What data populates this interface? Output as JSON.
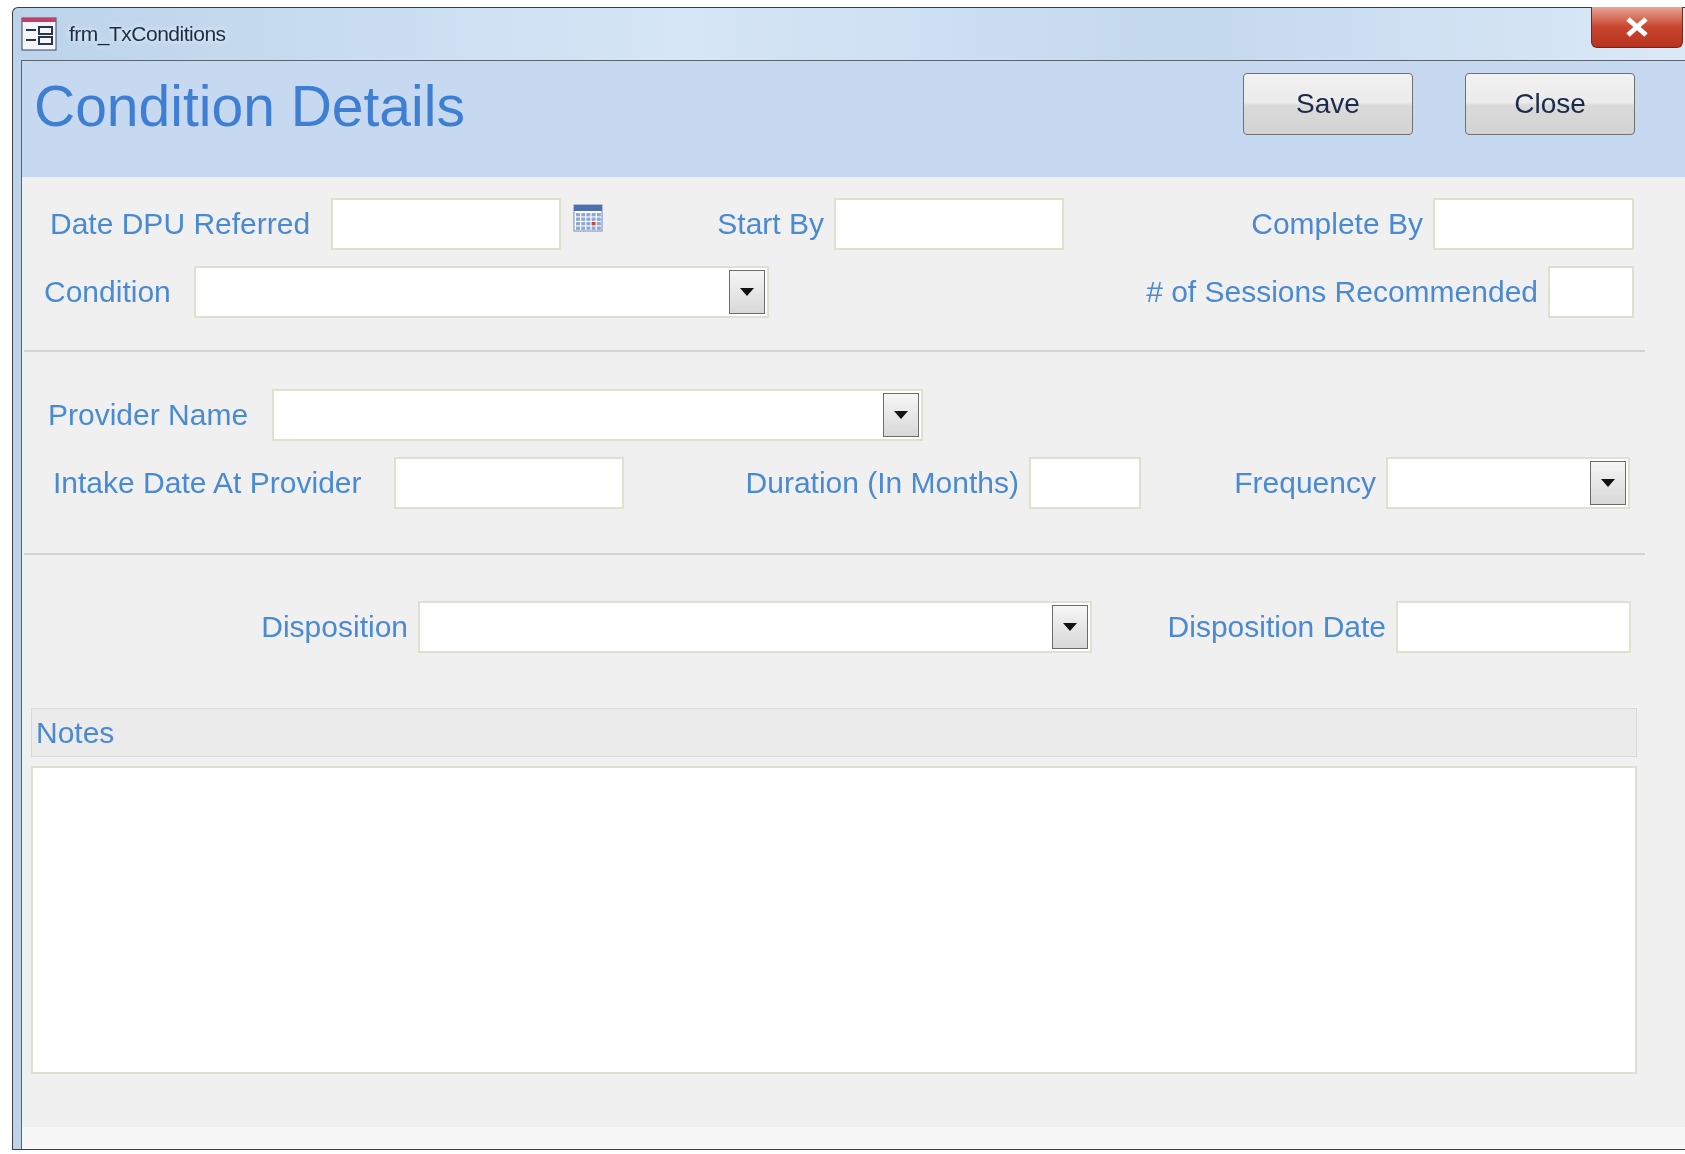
{
  "window": {
    "title": "frm_TxConditions"
  },
  "header": {
    "title": "Condition Details",
    "buttons": [
      "Save",
      "Close"
    ]
  },
  "sections": [
    {
      "lines": [
        {
          "fields": [
            {
              "label": "Date DPU Referred",
              "kind": "date"
            },
            {
              "label": "Start By",
              "kind": "text"
            },
            {
              "label": "Complete By",
              "kind": "text"
            }
          ]
        },
        {
          "fields": [
            {
              "label": "Condition",
              "kind": "combo"
            },
            {
              "label": "# of Sessions Recommended",
              "kind": "text"
            }
          ]
        }
      ]
    },
    {
      "lines": [
        {
          "fields": [
            {
              "label": "Provider Name",
              "kind": "combo"
            }
          ]
        },
        {
          "fields": [
            {
              "label": "Intake Date At Provider",
              "kind": "text"
            },
            {
              "label": "Duration (In Months)",
              "kind": "text"
            },
            {
              "label": "Frequency",
              "kind": "combo"
            }
          ]
        }
      ]
    },
    {
      "lines": [
        {
          "fields": [
            {
              "label": "Disposition",
              "kind": "combo"
            },
            {
              "label": "Disposition Date",
              "kind": "text"
            }
          ]
        }
      ]
    }
  ],
  "notes": {
    "label": "Notes"
  }
}
